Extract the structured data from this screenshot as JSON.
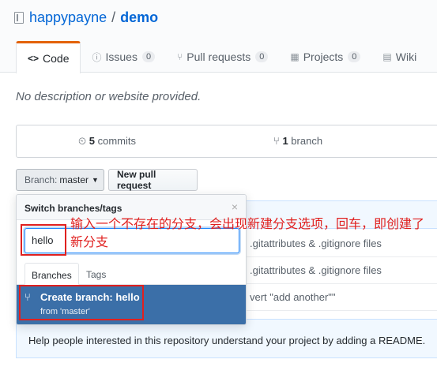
{
  "repo": {
    "owner": "happypayne",
    "separator": "/",
    "name": "demo"
  },
  "tabs": [
    {
      "icon": "code-icon",
      "glyph": "<>",
      "label": "Code",
      "count": ""
    },
    {
      "icon": "issue-icon",
      "glyph": "ⓘ",
      "label": "Issues",
      "count": "0"
    },
    {
      "icon": "pull-request-icon",
      "glyph": "⑂",
      "label": "Pull requests",
      "count": "0"
    },
    {
      "icon": "project-icon",
      "glyph": "▦",
      "label": "Projects",
      "count": "0"
    },
    {
      "icon": "wiki-icon",
      "glyph": "▤",
      "label": "Wiki",
      "count": ""
    }
  ],
  "description": "No description or website provided.",
  "summary": {
    "commits_count": "5",
    "commits_label": "commits",
    "branch_count": "1",
    "branch_label": "branch"
  },
  "buttons": {
    "branch_prefix": "Branch:",
    "branch_name": "master",
    "new_pr": "New pull request"
  },
  "dropdown": {
    "title": "Switch branches/tags",
    "close": "×",
    "input_value": "hello",
    "tab_branches": "Branches",
    "tab_tags": "Tags",
    "create_label": "Create branch: hello",
    "create_from": "from 'master'"
  },
  "files": [
    ".gitattributes & .gitignore files",
    ".gitattributes & .gitignore files",
    "vert \"add another\"\""
  ],
  "readme": "Help people interested in this repository understand your project by adding a README.",
  "annotation": "输入一个不存在的分支，会出现新建分支选项，回车，即创建了新分支",
  "colors": {
    "accent": "#0366d6",
    "highlight": "#e0201f",
    "selected": "#3b6fa8",
    "tab_active": "#e36209"
  }
}
